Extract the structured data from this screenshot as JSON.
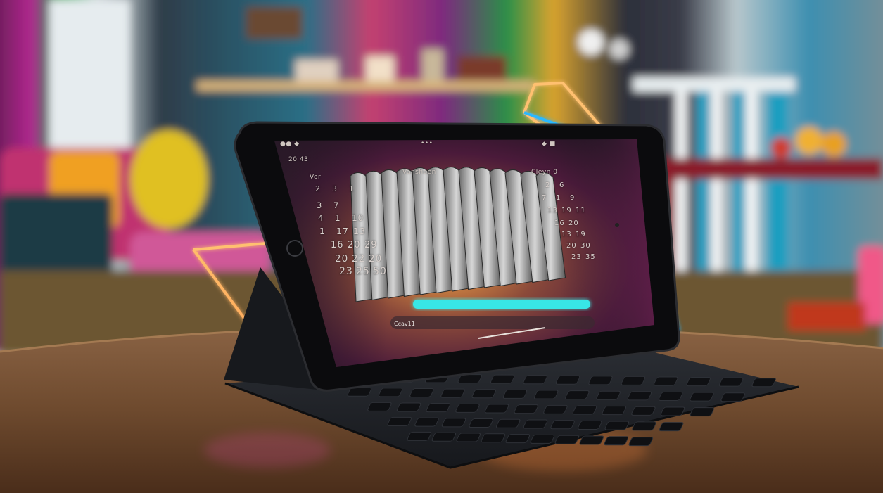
{
  "scene": {
    "description_type": "photo",
    "colors": {
      "wall_teal": "#1f6f80",
      "wall_magenta": "#a3348b",
      "wall_green": "#2e9c4a",
      "neon_orange": "#ffb35c",
      "neon_pink": "#ff3fd0",
      "neon_blue": "#2ab8ff",
      "slider_cyan": "#38e6e6",
      "table_wood": "#6e4a2e"
    }
  },
  "tablet": {
    "status_left": "●●  ◆",
    "status_center": "•••",
    "status_right": "◆ ■",
    "header_left": "20 43",
    "header_center": "Vanshoen",
    "header_right": "Cleyn 0"
  },
  "left_calendar": {
    "weekday_label": "Vor",
    "rows": [
      [
        "2",
        "3",
        "1"
      ],
      [
        "3",
        "7"
      ],
      [
        "4",
        "1",
        "10"
      ],
      [
        "1",
        "17",
        "13"
      ],
      [
        "16",
        "20",
        "29"
      ],
      [
        "20",
        "22",
        "20"
      ],
      [
        "23",
        "25",
        "50"
      ]
    ]
  },
  "right_calendar": {
    "rows": [
      [
        "2",
        "6"
      ],
      [
        "7",
        "1",
        "9"
      ],
      [
        "13",
        "19",
        "11"
      ],
      [
        "16",
        "20"
      ],
      [
        "13",
        "19"
      ],
      [
        "20",
        "30"
      ],
      [
        "23",
        "35"
      ]
    ]
  },
  "slider": {
    "label": "Ccav11",
    "value_fraction": 0.95
  }
}
